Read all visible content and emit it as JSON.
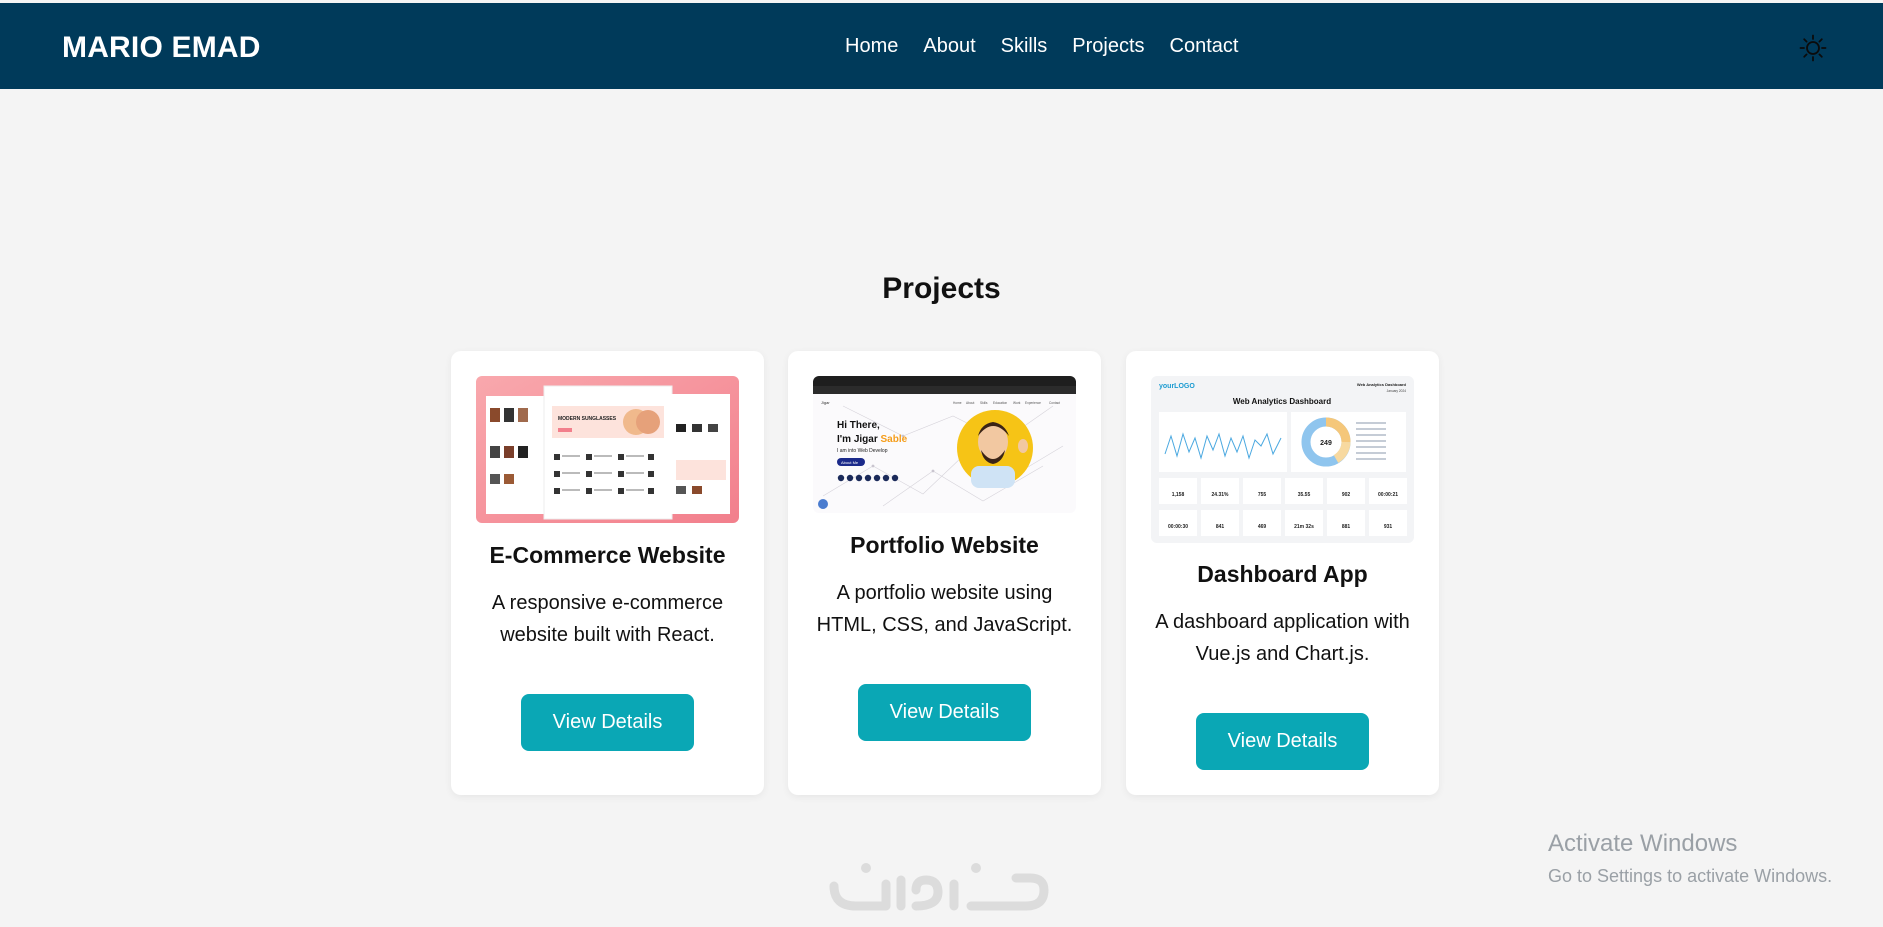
{
  "header": {
    "brand": "MARIO EMAD",
    "nav": [
      "Home",
      "About",
      "Skills",
      "Projects",
      "Contact"
    ],
    "theme_icon": "sun-icon"
  },
  "projects": {
    "title": "Projects",
    "cards": [
      {
        "title": "E-Commerce Website",
        "description": "A responsive e-commerce website built with React.",
        "button": "View Details",
        "thumbnail": {
          "banner_text": "MODERN SUNGLASSES"
        }
      },
      {
        "title": "Portfolio Website",
        "description": "A portfolio website using HTML, CSS, and JavaScript.",
        "button": "View Details",
        "thumbnail": {
          "greeting": "Hi There,",
          "name_prefix": "I'm Jigar",
          "name_highlight": "Sable",
          "role": "I am into Web Develop",
          "cta": "About Me"
        }
      },
      {
        "title": "Dashboard App",
        "description": "A dashboard application with Vue.js and Chart.js.",
        "button": "View Details",
        "thumbnail": {
          "logo": "yourLOGO",
          "header_right": "Web Analytics Dashboard",
          "date": "January 2024",
          "title": "Web Analytics Dashboard",
          "donut_value": "249",
          "stats_row1": [
            "1,158",
            "24.31%",
            "755",
            "35.55",
            "902",
            "00:00:21"
          ],
          "stats_row2": [
            "00:00:30",
            "841",
            "469",
            "21m 32s",
            "881",
            "931"
          ]
        }
      }
    ]
  },
  "watermark": {
    "activate_title": "Activate Windows",
    "activate_sub": "Go to Settings to activate Windows."
  },
  "colors": {
    "nav_bg": "#003a5a",
    "accent": "#0aa7b5",
    "page_bg": "#f4f4f4"
  }
}
